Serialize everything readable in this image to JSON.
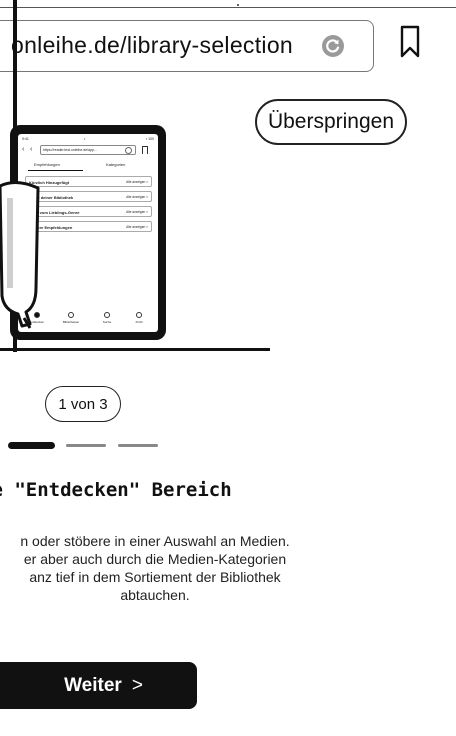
{
  "browser": {
    "url": "onleihe.de/library-selection"
  },
  "skip_button": {
    "label": "Überspringen"
  },
  "tablet_mockup": {
    "status_left": "9:41",
    "status_center": "•",
    "status_right": "▪ 100",
    "url": "https://reader.test.onleihe.de/app…",
    "tabs": [
      "Empfehlungen",
      "Kategorien"
    ],
    "rows": [
      {
        "title": "Kürzlich Hinzugefügt",
        "link": "Alle anzeigen  >"
      },
      {
        "title": "Tipps deiner Bibliothek",
        "link": "Alle anzeigen  >"
      },
      {
        "title": "Mehr vom Lieblings-Genre",
        "link": "Alle anzeigen  >"
      },
      {
        "title": "Weitere Empfehlungen",
        "link": "Alle anzeigen  >"
      }
    ],
    "bottom_nav": [
      "Entdecken",
      "Bibliotheken",
      "Suche",
      "Profil"
    ]
  },
  "pager": {
    "counter": "1 von 3",
    "current": 1,
    "total": 3
  },
  "content": {
    "heading": "ue \"Entdecken\" Bereich",
    "body_lines": [
      "n oder stöbere in einer Auswahl an Medien.",
      "er aber auch durch die Medien-Kategorien",
      "anz tief in dem Sortiement der Bibliothek",
      "abtauchen."
    ]
  },
  "next_button": {
    "label": "Weiter",
    "chevron": ">"
  }
}
